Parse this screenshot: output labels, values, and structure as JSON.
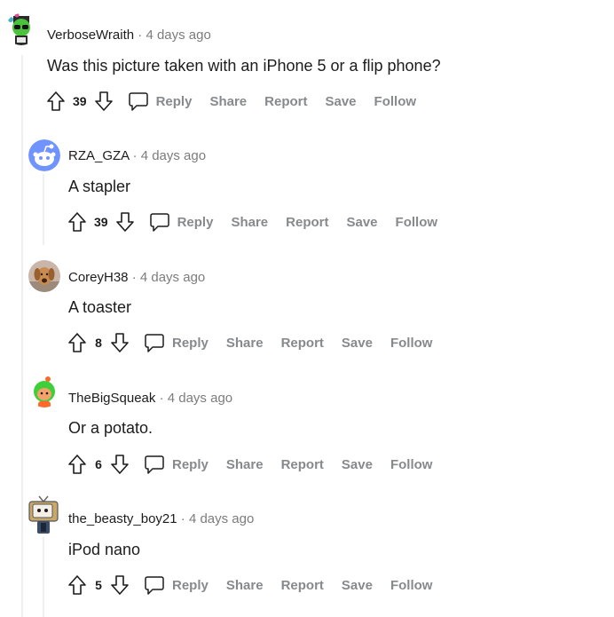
{
  "actions": {
    "reply": "Reply",
    "share": "Share",
    "report": "Report",
    "save": "Save",
    "follow": "Follow"
  },
  "comments": [
    {
      "author": "VerboseWraith",
      "meta": "· 4 days ago",
      "body": "Was this picture taken with an iPhone 5 or a flip phone?",
      "votes": "39",
      "avatar": "green-robot-avatar"
    },
    {
      "author": "RZA_GZA",
      "meta": "· 4 days ago",
      "body": "A stapler",
      "votes": "39",
      "avatar": "default-snoo-avatar"
    },
    {
      "author": "CoreyH38",
      "meta": "· 4 days ago",
      "body": "A toaster",
      "votes": "8",
      "avatar": "dog-photo-avatar"
    },
    {
      "author": "TheBigSqueak",
      "meta": "· 4 days ago",
      "body": "Or a potato.",
      "votes": "6",
      "avatar": "green-hair-snoo-avatar"
    },
    {
      "author": "the_beasty_boy21",
      "meta": "· 4 days ago",
      "body": "iPod nano",
      "votes": "5",
      "avatar": "tv-head-snoo-avatar"
    }
  ],
  "colors": {
    "text": "#1c1c1c",
    "meta": "#7c7c7c",
    "action": "#878a8c",
    "thread_line": "#edeff1"
  }
}
